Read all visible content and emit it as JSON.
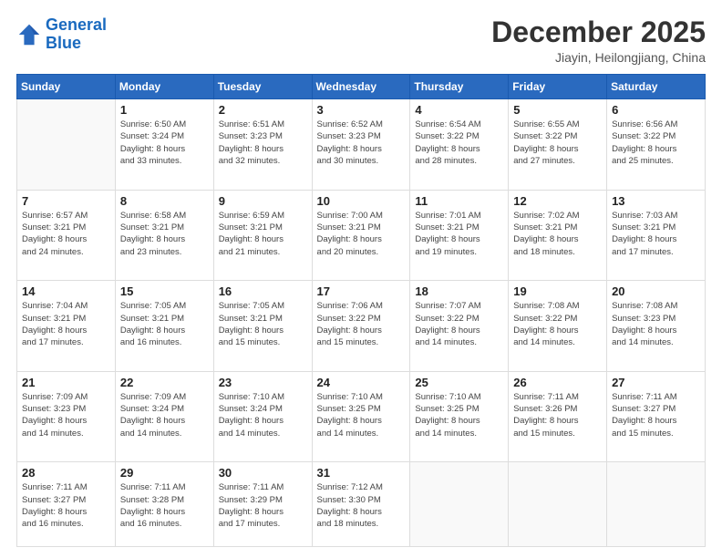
{
  "header": {
    "logo_line1": "General",
    "logo_line2": "Blue",
    "month_year": "December 2025",
    "location": "Jiayin, Heilongjiang, China"
  },
  "days_of_week": [
    "Sunday",
    "Monday",
    "Tuesday",
    "Wednesday",
    "Thursday",
    "Friday",
    "Saturday"
  ],
  "weeks": [
    [
      {
        "day": "",
        "info": ""
      },
      {
        "day": "1",
        "info": "Sunrise: 6:50 AM\nSunset: 3:24 PM\nDaylight: 8 hours\nand 33 minutes."
      },
      {
        "day": "2",
        "info": "Sunrise: 6:51 AM\nSunset: 3:23 PM\nDaylight: 8 hours\nand 32 minutes."
      },
      {
        "day": "3",
        "info": "Sunrise: 6:52 AM\nSunset: 3:23 PM\nDaylight: 8 hours\nand 30 minutes."
      },
      {
        "day": "4",
        "info": "Sunrise: 6:54 AM\nSunset: 3:22 PM\nDaylight: 8 hours\nand 28 minutes."
      },
      {
        "day": "5",
        "info": "Sunrise: 6:55 AM\nSunset: 3:22 PM\nDaylight: 8 hours\nand 27 minutes."
      },
      {
        "day": "6",
        "info": "Sunrise: 6:56 AM\nSunset: 3:22 PM\nDaylight: 8 hours\nand 25 minutes."
      }
    ],
    [
      {
        "day": "7",
        "info": "Sunrise: 6:57 AM\nSunset: 3:21 PM\nDaylight: 8 hours\nand 24 minutes."
      },
      {
        "day": "8",
        "info": "Sunrise: 6:58 AM\nSunset: 3:21 PM\nDaylight: 8 hours\nand 23 minutes."
      },
      {
        "day": "9",
        "info": "Sunrise: 6:59 AM\nSunset: 3:21 PM\nDaylight: 8 hours\nand 21 minutes."
      },
      {
        "day": "10",
        "info": "Sunrise: 7:00 AM\nSunset: 3:21 PM\nDaylight: 8 hours\nand 20 minutes."
      },
      {
        "day": "11",
        "info": "Sunrise: 7:01 AM\nSunset: 3:21 PM\nDaylight: 8 hours\nand 19 minutes."
      },
      {
        "day": "12",
        "info": "Sunrise: 7:02 AM\nSunset: 3:21 PM\nDaylight: 8 hours\nand 18 minutes."
      },
      {
        "day": "13",
        "info": "Sunrise: 7:03 AM\nSunset: 3:21 PM\nDaylight: 8 hours\nand 17 minutes."
      }
    ],
    [
      {
        "day": "14",
        "info": "Sunrise: 7:04 AM\nSunset: 3:21 PM\nDaylight: 8 hours\nand 17 minutes."
      },
      {
        "day": "15",
        "info": "Sunrise: 7:05 AM\nSunset: 3:21 PM\nDaylight: 8 hours\nand 16 minutes."
      },
      {
        "day": "16",
        "info": "Sunrise: 7:05 AM\nSunset: 3:21 PM\nDaylight: 8 hours\nand 15 minutes."
      },
      {
        "day": "17",
        "info": "Sunrise: 7:06 AM\nSunset: 3:22 PM\nDaylight: 8 hours\nand 15 minutes."
      },
      {
        "day": "18",
        "info": "Sunrise: 7:07 AM\nSunset: 3:22 PM\nDaylight: 8 hours\nand 14 minutes."
      },
      {
        "day": "19",
        "info": "Sunrise: 7:08 AM\nSunset: 3:22 PM\nDaylight: 8 hours\nand 14 minutes."
      },
      {
        "day": "20",
        "info": "Sunrise: 7:08 AM\nSunset: 3:23 PM\nDaylight: 8 hours\nand 14 minutes."
      }
    ],
    [
      {
        "day": "21",
        "info": "Sunrise: 7:09 AM\nSunset: 3:23 PM\nDaylight: 8 hours\nand 14 minutes."
      },
      {
        "day": "22",
        "info": "Sunrise: 7:09 AM\nSunset: 3:24 PM\nDaylight: 8 hours\nand 14 minutes."
      },
      {
        "day": "23",
        "info": "Sunrise: 7:10 AM\nSunset: 3:24 PM\nDaylight: 8 hours\nand 14 minutes."
      },
      {
        "day": "24",
        "info": "Sunrise: 7:10 AM\nSunset: 3:25 PM\nDaylight: 8 hours\nand 14 minutes."
      },
      {
        "day": "25",
        "info": "Sunrise: 7:10 AM\nSunset: 3:25 PM\nDaylight: 8 hours\nand 14 minutes."
      },
      {
        "day": "26",
        "info": "Sunrise: 7:11 AM\nSunset: 3:26 PM\nDaylight: 8 hours\nand 15 minutes."
      },
      {
        "day": "27",
        "info": "Sunrise: 7:11 AM\nSunset: 3:27 PM\nDaylight: 8 hours\nand 15 minutes."
      }
    ],
    [
      {
        "day": "28",
        "info": "Sunrise: 7:11 AM\nSunset: 3:27 PM\nDaylight: 8 hours\nand 16 minutes."
      },
      {
        "day": "29",
        "info": "Sunrise: 7:11 AM\nSunset: 3:28 PM\nDaylight: 8 hours\nand 16 minutes."
      },
      {
        "day": "30",
        "info": "Sunrise: 7:11 AM\nSunset: 3:29 PM\nDaylight: 8 hours\nand 17 minutes."
      },
      {
        "day": "31",
        "info": "Sunrise: 7:12 AM\nSunset: 3:30 PM\nDaylight: 8 hours\nand 18 minutes."
      },
      {
        "day": "",
        "info": ""
      },
      {
        "day": "",
        "info": ""
      },
      {
        "day": "",
        "info": ""
      }
    ]
  ]
}
